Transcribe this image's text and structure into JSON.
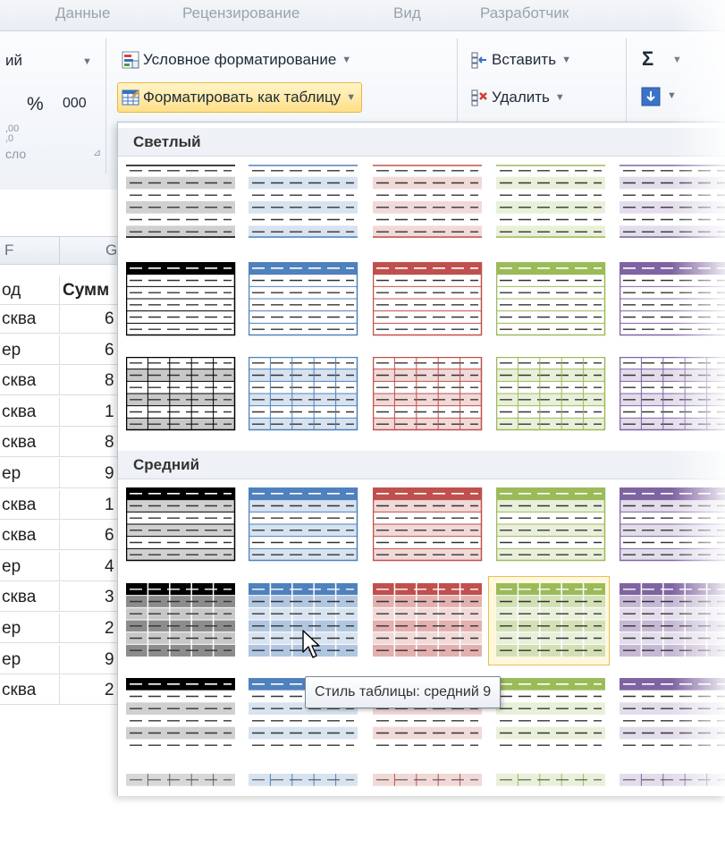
{
  "tabs": [
    "Данные",
    "Рецензирование",
    "Вид",
    "Разработчик"
  ],
  "ribbon": {
    "number_group": {
      "format_value": "ий",
      "percent": "%",
      "thousands": "000",
      "decimals": ",00\n,0",
      "group_label": "сло"
    },
    "conditional_formatting": "Условное форматирование",
    "format_as_table": "Форматировать как таблицу",
    "insert": "Вставить",
    "delete": "Удалить",
    "sum_symbol": "Σ"
  },
  "sheet": {
    "columns": [
      "F",
      "G"
    ],
    "headers": [
      "од",
      "Сумм"
    ],
    "rows": [
      {
        "city": "сква",
        "sum": "6"
      },
      {
        "city": "ер",
        "sum": "6"
      },
      {
        "city": "сква",
        "sum": "8"
      },
      {
        "city": "сква",
        "sum": "1"
      },
      {
        "city": "сква",
        "sum": "8"
      },
      {
        "city": "ер",
        "sum": "9"
      },
      {
        "city": "сква",
        "sum": "1"
      },
      {
        "city": "сква",
        "sum": "6"
      },
      {
        "city": "ер",
        "sum": "4"
      },
      {
        "city": "сква",
        "sum": "3"
      },
      {
        "city": "ер",
        "sum": "2"
      },
      {
        "city": "ер",
        "sum": "9"
      },
      {
        "city": "сква",
        "sum": "2"
      }
    ]
  },
  "gallery": {
    "sections": [
      "Светлый",
      "Средний"
    ],
    "tooltip": "Стиль таблицы: средний 9",
    "palette": [
      "#000000",
      "#4f81bd",
      "#c0504d",
      "#9bbb59",
      "#8064a2"
    ]
  }
}
